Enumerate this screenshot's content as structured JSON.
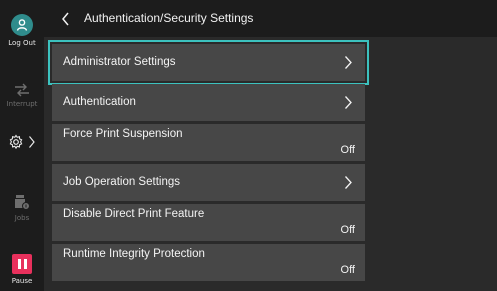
{
  "header": {
    "title": "Authentication/Security Settings"
  },
  "rail": {
    "logout_label": "Log Out",
    "interrupt_label": "Interrupt",
    "jobs_label": "Jobs",
    "pause_label": "Pause"
  },
  "list": {
    "items": [
      {
        "label": "Administrator Settings",
        "value": "",
        "has_chevron": true,
        "selected": true
      },
      {
        "label": "Authentication",
        "value": "",
        "has_chevron": true,
        "selected": false
      },
      {
        "label": "Force Print Suspension",
        "value": "Off",
        "has_chevron": false,
        "selected": false
      },
      {
        "label": "Job Operation Settings",
        "value": "",
        "has_chevron": true,
        "selected": false
      },
      {
        "label": "Disable Direct Print Feature",
        "value": "Off",
        "has_chevron": false,
        "selected": false
      },
      {
        "label": "Runtime Integrity Protection",
        "value": "Off",
        "has_chevron": false,
        "selected": false
      }
    ]
  },
  "colors": {
    "accent": "#3cc2bf",
    "row_bg": "#474747",
    "pause": "#e8305c",
    "logout": "#2f8c8c"
  },
  "icons": {
    "logout": "logout-person-icon",
    "interrupt": "interrupt-icon",
    "settings": "gear-icon",
    "jobs": "jobs-icon",
    "pause": "pause-icon",
    "back": "chevron-left-icon",
    "row": "chevron-right-icon"
  }
}
